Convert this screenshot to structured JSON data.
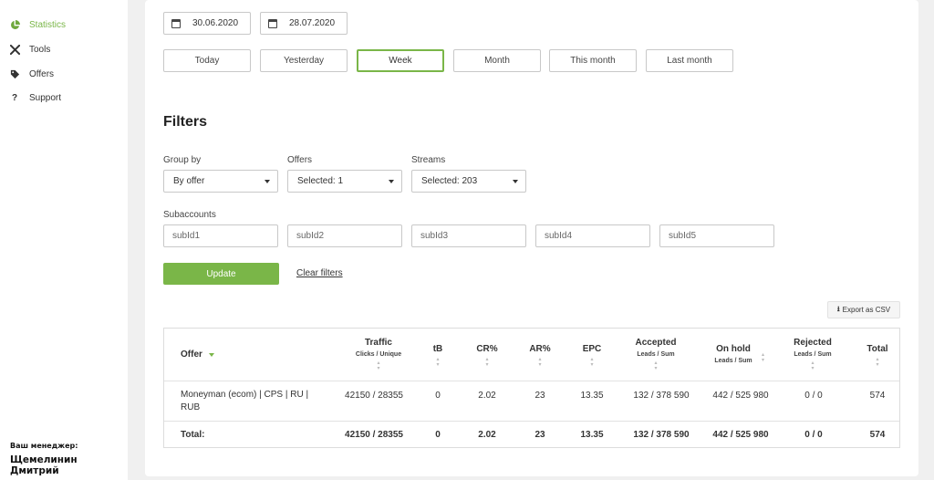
{
  "sidebar": {
    "items": [
      {
        "label": "Statistics",
        "icon": "pie-chart-icon",
        "active": true
      },
      {
        "label": "Tools",
        "icon": "tools-icon",
        "active": false
      },
      {
        "label": "Offers",
        "icon": "tag-icon",
        "active": false
      },
      {
        "label": "Support",
        "icon": "question-icon",
        "active": false
      }
    ],
    "manager_label": "Ваш менеджер:",
    "manager_name": "Щемелинин Дмитрий"
  },
  "dates": {
    "from": "30.06.2020",
    "to": "28.07.2020"
  },
  "periods": [
    {
      "label": "Today",
      "active": false
    },
    {
      "label": "Yesterday",
      "active": false
    },
    {
      "label": "Week",
      "active": true
    },
    {
      "label": "Month",
      "active": false
    },
    {
      "label": "This month",
      "active": false
    },
    {
      "label": "Last month",
      "active": false
    }
  ],
  "filters": {
    "title": "Filters",
    "group_by": {
      "label": "Group by",
      "value": "By offer"
    },
    "offers": {
      "label": "Offers",
      "value": "Selected: 1"
    },
    "streams": {
      "label": "Streams",
      "value": "Selected: 203"
    },
    "subaccounts": {
      "label": "Subaccounts",
      "placeholders": [
        "subId1",
        "subId2",
        "subId3",
        "subId4",
        "subId5"
      ]
    },
    "update_label": "Update",
    "clear_label": "Clear filters"
  },
  "export_label": "Export as CSV",
  "table": {
    "columns": {
      "offer": "Offer",
      "traffic": {
        "title": "Traffic",
        "sub": "Clicks / Unique"
      },
      "tb": "tB",
      "cr": "CR%",
      "ar": "AR%",
      "epc": "EPC",
      "accepted": {
        "title": "Accepted",
        "sub": "Leads / Sum"
      },
      "onhold": {
        "title": "On hold",
        "sub": "Leads / Sum"
      },
      "rejected": {
        "title": "Rejected",
        "sub": "Leads / Sum"
      },
      "total": "Total"
    },
    "row": {
      "offer": "Moneyman (ecom) | CPS | RU | RUB",
      "traffic": "42150 / 28355",
      "tb": "0",
      "cr": "2.02",
      "ar": "23",
      "epc": "13.35",
      "accepted": "132 / 378 590",
      "onhold": "442 / 525 980",
      "rejected": "0 / 0",
      "total": "574"
    },
    "totals": {
      "label": "Total:",
      "traffic": "42150 / 28355",
      "tb": "0",
      "cr": "2.02",
      "ar": "23",
      "epc": "13.35",
      "accepted": "132 / 378 590",
      "onhold": "442 / 525 980",
      "rejected": "0 / 0",
      "total": "574"
    }
  },
  "colors": {
    "accent": "#7ab648",
    "background": "#f0f0f0"
  }
}
